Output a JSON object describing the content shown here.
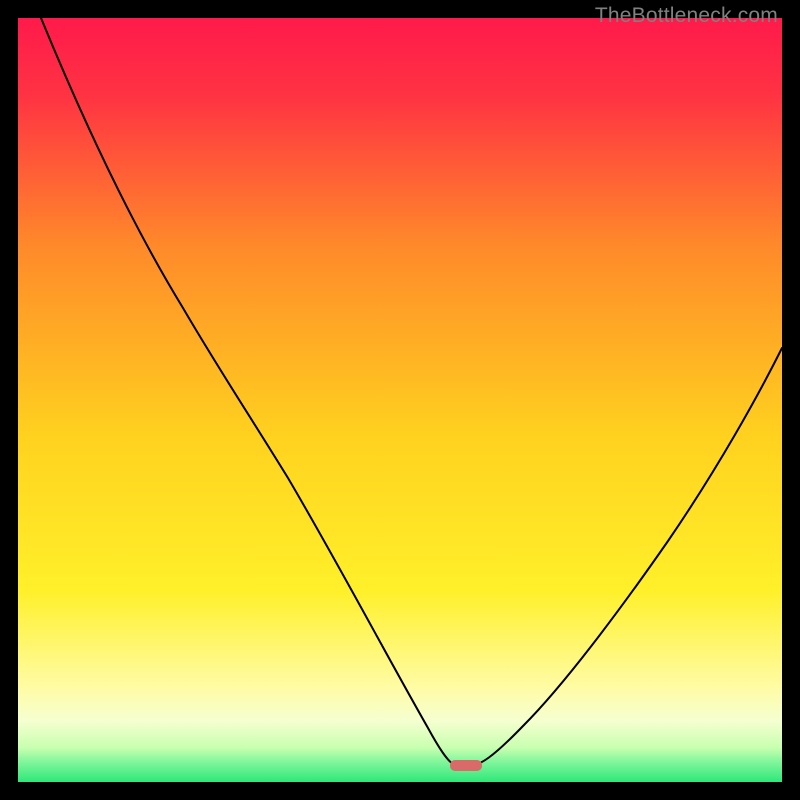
{
  "watermark": "TheBottleneck.com",
  "colors": {
    "background": "#000000",
    "gradient_top": "#ff1744",
    "gradient_mid1": "#ff8a00",
    "gradient_mid2": "#ffe600",
    "gradient_mid3": "#fff8a0",
    "gradient_bottom": "#2ee87a",
    "curve": "#000000",
    "marker": "#d96a6a"
  },
  "chart_data": {
    "type": "line",
    "title": "",
    "xlabel": "",
    "ylabel": "",
    "xlim": [
      0,
      100
    ],
    "ylim": [
      0,
      100
    ],
    "x": [
      3,
      10,
      20,
      27,
      35,
      44,
      50,
      54,
      56,
      57.5,
      59.5,
      62,
      66,
      73,
      80,
      88,
      96,
      100
    ],
    "values": [
      100,
      85,
      68,
      58,
      44,
      28,
      16,
      8,
      3.5,
      2.2,
      2.2,
      2.6,
      5,
      13,
      25,
      40,
      55,
      62
    ],
    "marker_x": 58.5,
    "marker_y": 2.2,
    "grid": false,
    "legend": false
  }
}
